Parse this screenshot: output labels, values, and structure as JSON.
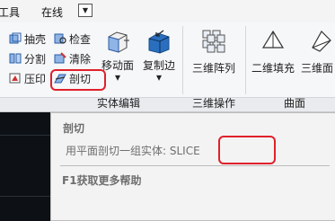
{
  "menubar": {
    "items": [
      "工具",
      "在线"
    ],
    "dropdown_icon": "▼"
  },
  "ribbon": {
    "solid_edit": {
      "small_tools": [
        {
          "label": "抽壳",
          "icon": "shell-icon"
        },
        {
          "label": "检查",
          "icon": "check-icon"
        },
        {
          "label": "分割",
          "icon": "separate-icon"
        },
        {
          "label": "清除",
          "icon": "clean-icon"
        },
        {
          "label": "压印",
          "icon": "imprint-icon"
        },
        {
          "label": "剖切",
          "icon": "slice-icon"
        }
      ],
      "move_face": {
        "label": "移动面",
        "arrow": "▾"
      },
      "copy_edge": {
        "label": "复制边",
        "arrow": "▾"
      },
      "group_label": "实体编辑"
    },
    "three_d_ops": {
      "array_3d": {
        "label": "三维阵列"
      },
      "group_label": "三维操作"
    },
    "surface": {
      "fill_2d": {
        "label": "二维填充"
      },
      "face_3d": {
        "label": "三维面"
      },
      "group_label": "曲面"
    }
  },
  "tooltip": {
    "title": "剖切",
    "description": "用平面剖切一组实体:  SLICE",
    "help": "F1获取更多帮助"
  },
  "colors": {
    "highlight": "#e0202a",
    "canvas": "#0d1014",
    "ribbon": "#f6f7f9"
  }
}
